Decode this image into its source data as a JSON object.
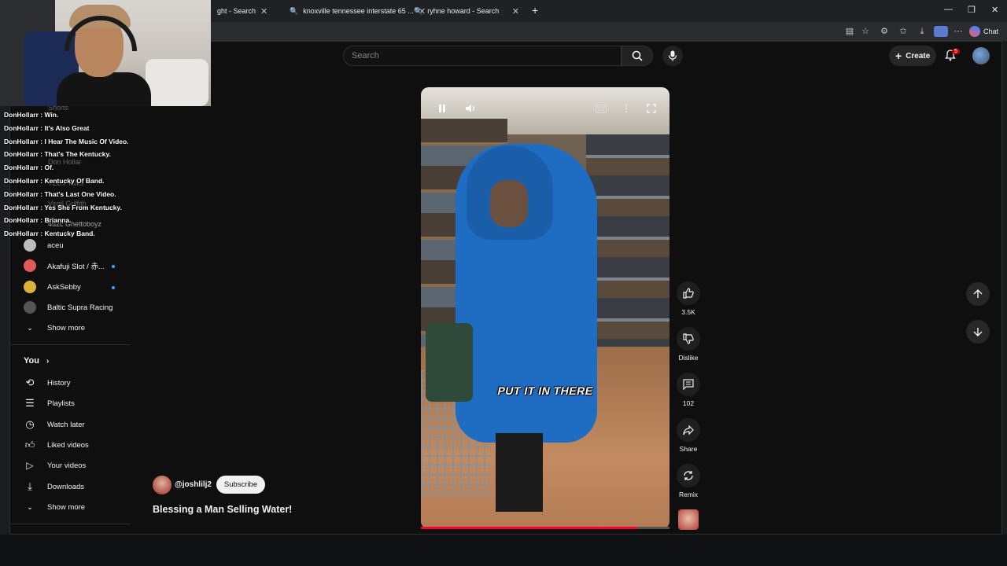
{
  "browser": {
    "tabs": [
      {
        "label": "ght - Search"
      },
      {
        "label": "knoxville tennessee interstate 65 ..."
      },
      {
        "label": "ryhne howard - Search"
      }
    ],
    "new_tab": "+",
    "chat_label": "Chat"
  },
  "header": {
    "search_placeholder": "Search",
    "create_label": "Create",
    "notification_count": "5"
  },
  "sidebar": {
    "shorts_label": "Shorts",
    "subscriptions": [
      {
        "label": "Don Hollar"
      },
      {
        "label": "TEDx Talks"
      },
      {
        "label": "Virgil Griffith"
      },
      {
        "label": "4u2c Ghettoboyz"
      },
      {
        "label": "aceu"
      },
      {
        "label": "Akafuji Slot / 赤..."
      },
      {
        "label": "AskSebby"
      },
      {
        "label": "Baltic Supra Racing"
      }
    ],
    "show_more_1": "Show more",
    "you_label": "You",
    "you_items": [
      {
        "label": "History"
      },
      {
        "label": "Playlists"
      },
      {
        "label": "Watch later"
      },
      {
        "label": "Liked videos"
      },
      {
        "label": "Your videos"
      },
      {
        "label": "Downloads"
      }
    ],
    "show_more_2": "Show more"
  },
  "chat": {
    "messages": [
      "DonHollarr : Win.",
      "DonHollarr : It's Also Great",
      "DonHollarr : I Hear The Music Of Video.",
      "DonHollarr : That's The Kentucky.",
      "DonHollarr : Of.",
      "DonHollarr : Kentucky Of Band.",
      "DonHollarr : That's Last One Video.",
      "DonHollarr : Yes She From Kentucky.",
      "DonHollarr : Brianna.",
      "DonHollarr : Kentucky Band."
    ]
  },
  "video": {
    "caption": "PUT IT IN THERE",
    "progress": 0.87,
    "channel": "@joshlilj2",
    "subscribe_label": "Subscribe",
    "title": "Blessing a Man Selling Water!"
  },
  "actions": {
    "like_count": "3.5K",
    "dislike_label": "Dislike",
    "comment_count": "102",
    "share_label": "Share",
    "remix_label": "Remix"
  },
  "colors": {
    "accent": "#ff0033",
    "link_blue": "#3ea6ff",
    "bg": "#0f0f0f"
  }
}
